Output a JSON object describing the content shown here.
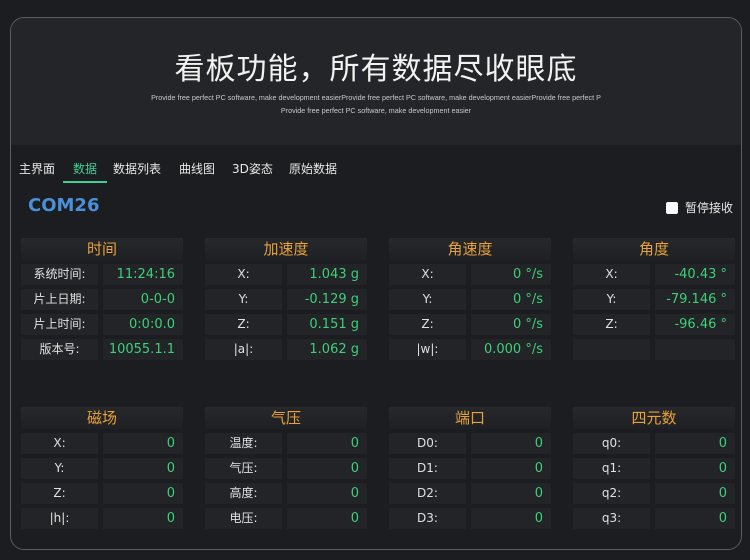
{
  "hero": {
    "title": "看板功能，所有数据尽收眼底",
    "subtitle_line1": "Provide free perfect PC software, make development easierProvide free perfect PC software, make development easierProvide free perfect P",
    "subtitle_line2": "Provide free perfect PC software, make development easier"
  },
  "tabs": [
    {
      "label": "主界面",
      "active": false
    },
    {
      "label": "数据",
      "active": true
    },
    {
      "label": "数据列表",
      "active": false
    },
    {
      "label": "曲线图",
      "active": false
    },
    {
      "label": "3D姿态",
      "active": false
    },
    {
      "label": "原始数据",
      "active": false
    }
  ],
  "port": "COM26",
  "pause_label": "暂停接收",
  "colors": {
    "accent": "#3ecf95",
    "value": "#3ecf78",
    "title": "#e8a23a",
    "port": "#4a90d9"
  },
  "panels": {
    "time": {
      "title": "时间",
      "rows": [
        {
          "label": "系统时间:",
          "value": "11:24:16"
        },
        {
          "label": "片上日期:",
          "value": "0-0-0"
        },
        {
          "label": "片上时间:",
          "value": "0:0:0.0"
        },
        {
          "label": "版本号:",
          "value": "10055.1.1"
        }
      ]
    },
    "accel": {
      "title": "加速度",
      "rows": [
        {
          "label": "X:",
          "value": "1.043 g"
        },
        {
          "label": "Y:",
          "value": "-0.129 g"
        },
        {
          "label": "Z:",
          "value": "0.151 g"
        },
        {
          "label": "|a|:",
          "value": "1.062 g"
        }
      ]
    },
    "gyro": {
      "title": "角速度",
      "rows": [
        {
          "label": "X:",
          "value": "0 °/s"
        },
        {
          "label": "Y:",
          "value": "0 °/s"
        },
        {
          "label": "Z:",
          "value": "0 °/s"
        },
        {
          "label": "|w|:",
          "value": "0.000 °/s"
        }
      ]
    },
    "angle": {
      "title": "角度",
      "rows": [
        {
          "label": "X:",
          "value": "-40.43 °"
        },
        {
          "label": "Y:",
          "value": "-79.146 °"
        },
        {
          "label": "Z:",
          "value": "-96.46 °"
        },
        {
          "label": "",
          "value": ""
        }
      ]
    },
    "mag": {
      "title": "磁场",
      "rows": [
        {
          "label": "X:",
          "value": "0"
        },
        {
          "label": "Y:",
          "value": "0"
        },
        {
          "label": "Z:",
          "value": "0"
        },
        {
          "label": "|h|:",
          "value": "0"
        }
      ]
    },
    "pressure": {
      "title": "气压",
      "rows": [
        {
          "label": "温度:",
          "value": "0"
        },
        {
          "label": "气压:",
          "value": "0"
        },
        {
          "label": "高度:",
          "value": "0"
        },
        {
          "label": "电压:",
          "value": "0"
        }
      ]
    },
    "portio": {
      "title": "端口",
      "rows": [
        {
          "label": "D0:",
          "value": "0"
        },
        {
          "label": "D1:",
          "value": "0"
        },
        {
          "label": "D2:",
          "value": "0"
        },
        {
          "label": "D3:",
          "value": "0"
        }
      ]
    },
    "quat": {
      "title": "四元数",
      "rows": [
        {
          "label": "q0:",
          "value": "0"
        },
        {
          "label": "q1:",
          "value": "0"
        },
        {
          "label": "q2:",
          "value": "0"
        },
        {
          "label": "q3:",
          "value": "0"
        }
      ]
    }
  }
}
